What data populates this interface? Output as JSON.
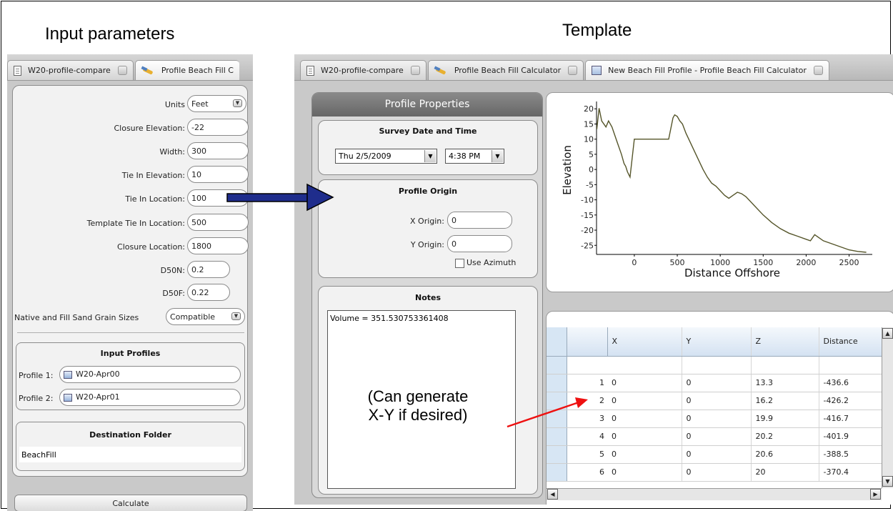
{
  "headings": {
    "left": "Input parameters",
    "right": "Template"
  },
  "left_tabs": [
    {
      "label": "W20-profile-compare"
    },
    {
      "label": "Profile Beach Fill C"
    }
  ],
  "inputs": [
    {
      "label": "Units",
      "value": "Feet",
      "dropdown": true
    },
    {
      "label": "Closure Elevation:",
      "value": "-22"
    },
    {
      "label": "Width:",
      "value": "300"
    },
    {
      "label": "Tie In Elevation:",
      "value": "10"
    },
    {
      "label": "Tie In Location:",
      "value": "100"
    },
    {
      "label": "Template Tie In Location:",
      "value": "500"
    },
    {
      "label": "Closure Location:",
      "value": "1800"
    },
    {
      "label": "D50N:",
      "value": "0.2"
    },
    {
      "label": "D50F:",
      "value": "0.22"
    },
    {
      "label": "Native and Fill Sand Grain Sizes",
      "value": "Compatible",
      "dropdown": true
    }
  ],
  "input_profiles": {
    "title": "Input Profiles",
    "p1_label": "Profile 1:",
    "p1_value": "W20-Apr00",
    "p2_label": "Profile 2:",
    "p2_value": "W20-Apr01"
  },
  "destination": {
    "title": "Destination Folder",
    "value": "BeachFill"
  },
  "calculate_label": "Calculate",
  "right_tabs": [
    {
      "label": "W20-profile-compare"
    },
    {
      "label": "Profile Beach Fill Calculator"
    },
    {
      "label": "New Beach Fill Profile - Profile Beach Fill Calculator"
    }
  ],
  "profile_properties": {
    "title": "Profile Properties",
    "survey_title": "Survey Date and Time",
    "date": "Thu  2/5/2009",
    "time": "4:38 PM",
    "origin_title": "Profile Origin",
    "x_label": "X Origin:",
    "x_value": "0",
    "y_label": "Y Origin:",
    "y_value": "0",
    "azimuth_label": "Use Azimuth",
    "notes_title": "Notes",
    "notes_text": "Volume = 351.530753361408"
  },
  "chart_data": {
    "type": "line",
    "xlabel": "Distance Offshore",
    "ylabel": "Elevation",
    "xlim": [
      -440,
      2720
    ],
    "ylim": [
      -28,
      21
    ],
    "xticks": [
      0,
      500,
      1000,
      1500,
      2000,
      2500
    ],
    "yticks": [
      20,
      15,
      10,
      5,
      0,
      -5,
      -10,
      -15,
      -20,
      -25
    ],
    "x": [
      -437,
      -410,
      -380,
      -330,
      -300,
      -260,
      -200,
      -150,
      -120,
      -100,
      -80,
      -50,
      0,
      50,
      100,
      150,
      200,
      250,
      300,
      350,
      400,
      450,
      470,
      500,
      530,
      560,
      600,
      650,
      700,
      750,
      800,
      850,
      900,
      950,
      1000,
      1050,
      1100,
      1150,
      1200,
      1250,
      1300,
      1400,
      1500,
      1600,
      1700,
      1800,
      1900,
      2000,
      2050,
      2100,
      2200,
      2300,
      2400,
      2500,
      2600,
      2700
    ],
    "y": [
      13.3,
      20.2,
      16.0,
      14.0,
      16.0,
      14.0,
      9.0,
      5.0,
      2.0,
      1.0,
      -0.8,
      -2.5,
      10.0,
      10.0,
      10.0,
      10.0,
      10.0,
      10.0,
      10.0,
      10.0,
      10.0,
      17.0,
      18.0,
      17.5,
      16.0,
      15.0,
      12.0,
      9.0,
      6.0,
      3.0,
      0.0,
      -2.5,
      -4.5,
      -5.5,
      -7.0,
      -8.5,
      -9.5,
      -8.5,
      -7.5,
      -8.0,
      -9.0,
      -12.0,
      -15.0,
      -17.5,
      -19.5,
      -21.0,
      -22.0,
      -23.0,
      -23.5,
      -21.5,
      -23.5,
      -24.5,
      -25.5,
      -26.5,
      -27.0,
      -27.3
    ]
  },
  "table": {
    "columns": [
      "X",
      "Y",
      "Z",
      "Distance"
    ],
    "rows": [
      {
        "n": "1",
        "x": "0",
        "y": "0",
        "z": "13.3",
        "d": "-436.6"
      },
      {
        "n": "2",
        "x": "0",
        "y": "0",
        "z": "16.2",
        "d": "-426.2"
      },
      {
        "n": "3",
        "x": "0",
        "y": "0",
        "z": "19.9",
        "d": "-416.7"
      },
      {
        "n": "4",
        "x": "0",
        "y": "0",
        "z": "20.2",
        "d": "-401.9"
      },
      {
        "n": "5",
        "x": "0",
        "y": "0",
        "z": "20.6",
        "d": "-388.5"
      },
      {
        "n": "6",
        "x": "0",
        "y": "0",
        "z": "20",
        "d": "-370.4"
      }
    ]
  },
  "annotation": {
    "line1": "(Can generate",
    "line2": "X-Y if desired)"
  },
  "colors": {
    "panel_bg": "#c9c9c9",
    "box_bg": "#f2f2f2",
    "header_bg": "#707070",
    "curve": "#55552a",
    "blue_arrow": "#1f2d8c",
    "red_arrow": "#ee1111"
  }
}
